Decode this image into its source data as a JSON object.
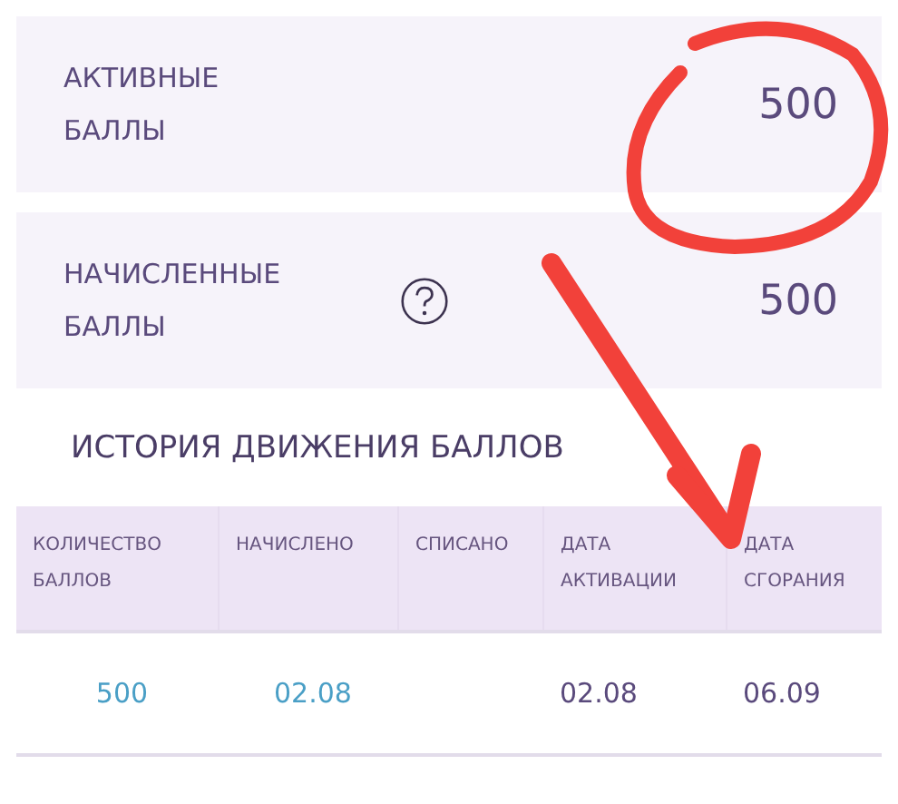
{
  "summary_cards": [
    {
      "label_lines": [
        "АКТИВНЫЕ",
        "БАЛЛЫ"
      ],
      "help_icon": false,
      "value": "500"
    },
    {
      "label_lines": [
        "НАЧИСЛЕННЫЕ",
        "БАЛЛЫ"
      ],
      "help_icon": true,
      "value": "500"
    }
  ],
  "history": {
    "title": "ИСТОРИЯ ДВИЖЕНИЯ БАЛЛОВ",
    "columns": [
      "КОЛИЧЕСТВО БАЛЛОВ",
      "НАЧИСЛЕНО",
      "СПИСАНО",
      "ДАТА АКТИВАЦИИ",
      "ДАТА СГОРАНИЯ"
    ],
    "rows": [
      [
        {
          "text": "500",
          "link": true
        },
        {
          "text": "02.08",
          "link": true
        },
        null,
        {
          "text": "02.08",
          "link": false
        },
        {
          "text": "06.09",
          "link": false
        }
      ]
    ]
  }
}
